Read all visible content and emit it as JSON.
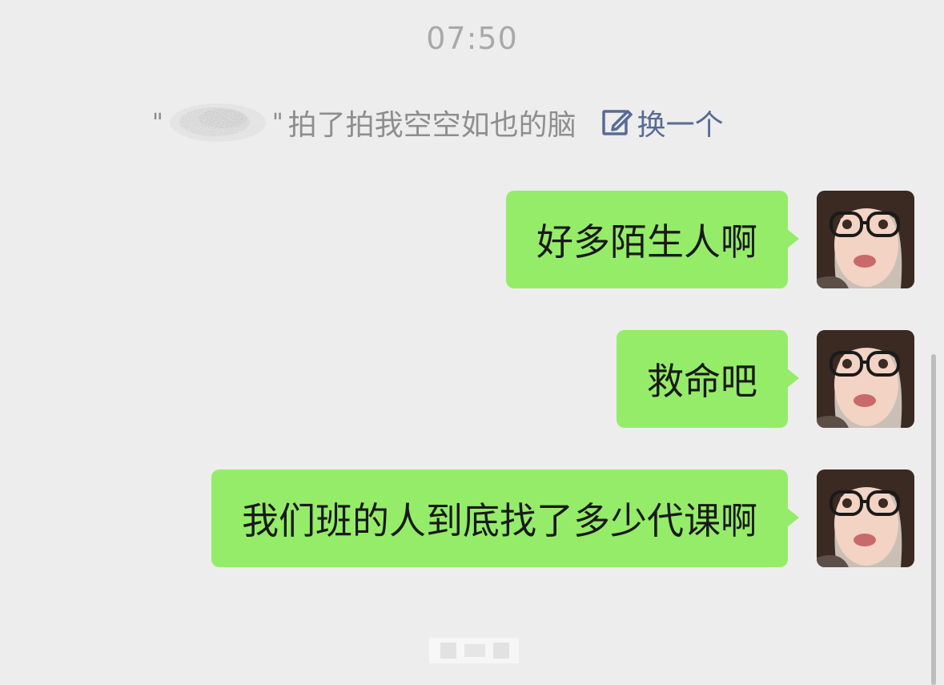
{
  "chat": {
    "timestamp": "07:50",
    "pat_notice": {
      "quote_open": "\"",
      "quote_close": "\"",
      "text": "拍了拍我空空如也的脑",
      "change_label": "换一个"
    },
    "messages": [
      {
        "text": "好多陌生人啊",
        "from": "me"
      },
      {
        "text": "救命吧",
        "from": "me"
      },
      {
        "text": "我们班的人到底找了多少代课啊",
        "from": "me"
      }
    ]
  },
  "colors": {
    "background": "#ededed",
    "bubble_green": "#95ec69",
    "link_blue": "#576b95",
    "timestamp_gray": "#a9a9a9"
  },
  "icons": {
    "edit": "edit-icon",
    "avatar": "avatar-photo"
  }
}
